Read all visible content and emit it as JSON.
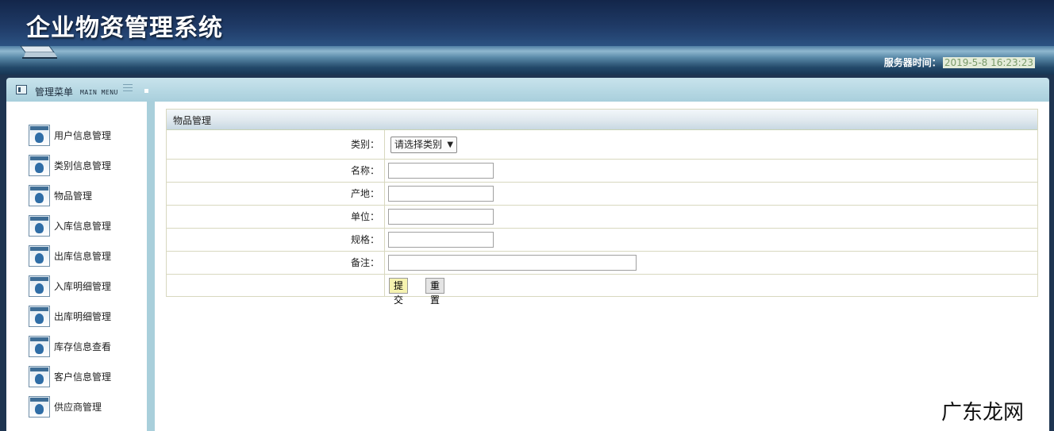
{
  "header": {
    "app_title": "企业物资管理系统",
    "server_time_label": "服务器时间：",
    "server_time_value": "2019-5-8 16:23:23"
  },
  "menu_bar": {
    "title": "管理菜单",
    "subtitle": "MAIN MENU"
  },
  "sidebar": {
    "items": [
      {
        "label": "用户信息管理"
      },
      {
        "label": "类别信息管理"
      },
      {
        "label": "物品管理"
      },
      {
        "label": "入库信息管理"
      },
      {
        "label": "出库信息管理"
      },
      {
        "label": "入库明细管理"
      },
      {
        "label": "出库明细管理"
      },
      {
        "label": "库存信息查看"
      },
      {
        "label": "客户信息管理"
      },
      {
        "label": "供应商管理"
      }
    ]
  },
  "form": {
    "title": "物品管理",
    "category_label": "类别：",
    "category_selected": "请选择类别",
    "name_label": "名称：",
    "name_value": "",
    "origin_label": "产地：",
    "origin_value": "",
    "unit_label": "单位：",
    "unit_value": "",
    "spec_label": "规格：",
    "spec_value": "",
    "remark_label": "备注：",
    "remark_value": "",
    "submit_label": "提交",
    "reset_label": "重置"
  },
  "watermark": "广东龙网",
  "colors": {
    "header_dark": "#13264a",
    "menu_bar": "#a8cfdc",
    "submit_button": "#f6f3b0",
    "time_bg": "#e4ecd9"
  }
}
